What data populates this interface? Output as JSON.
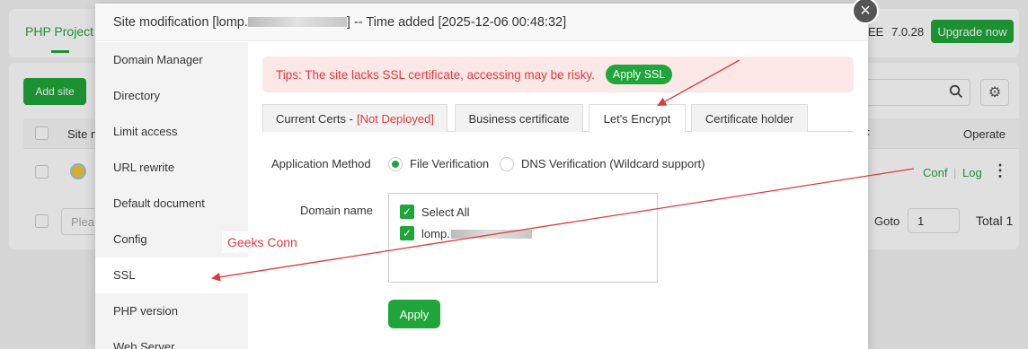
{
  "background": {
    "tab_label": "PHP Project",
    "version_prefix": "EE",
    "version": "7.0.28",
    "upgrade_label": "Upgrade now",
    "add_site_label": "Add site",
    "table_header_site": "Site n",
    "table_header_f": "F",
    "table_header_operate": "Operate",
    "row_actions": {
      "conf": "Conf",
      "separator": "|",
      "log": "Log",
      "more": "⋮"
    },
    "page_size_placeholder": "Plea",
    "goto_label": "Goto",
    "goto_value": "1",
    "total_label": "Total 1"
  },
  "modal": {
    "title_prefix": "Site modification [lomp.",
    "title_suffix": "] -- Time added [2025-12-06 00:48:32]",
    "close_symbol": "×",
    "sidebar": [
      {
        "label": "Domain Manager"
      },
      {
        "label": "Directory"
      },
      {
        "label": "Limit access"
      },
      {
        "label": "URL rewrite"
      },
      {
        "label": "Default document"
      },
      {
        "label": "Config"
      },
      {
        "label": "SSL"
      },
      {
        "label": "PHP version"
      },
      {
        "label": "Web Server"
      }
    ],
    "tips_text": "Tips: The site lacks SSL certificate, accessing may be risky.",
    "apply_ssl_label": "Apply SSL",
    "tabs": {
      "current_certs": "Current Certs - ",
      "not_deployed": "[Not Deployed]",
      "business": "Business certificate",
      "lets_encrypt": "Let's Encrypt",
      "holder": "Certificate holder"
    },
    "method_label": "Application Method",
    "method_options": [
      "File Verification",
      "DNS Verification (Wildcard support)"
    ],
    "domain_label": "Domain name",
    "domains": {
      "select_all": "Select All",
      "item_prefix": "lomp."
    },
    "apply_label": "Apply"
  },
  "annotation": {
    "text": "Geeks Conn",
    "color": "#e0393a"
  },
  "colors": {
    "accent": "#20a53a",
    "danger": "#e0393a",
    "tips_bg": "#fde8e8"
  }
}
